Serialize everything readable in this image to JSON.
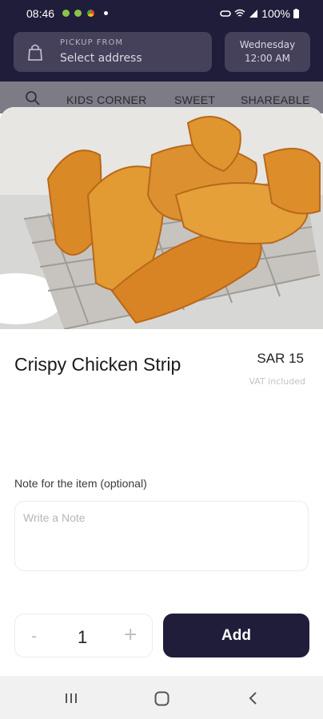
{
  "status_bar": {
    "time": "08:46",
    "battery": "100%",
    "notification_icons": [
      "android-icon",
      "android-icon",
      "chrome-icon",
      "dot-icon"
    ]
  },
  "header": {
    "pickup_label": "PICKUP FROM",
    "pickup_value": "Select address",
    "date_day": "Wednesday",
    "date_time": "12:00 AM"
  },
  "categories": [
    "KIDS CORNER",
    "SWEET",
    "SHAREABLE"
  ],
  "item": {
    "name": "Crispy Chicken Strip",
    "price": "SAR 15",
    "vat_note": "VAT included"
  },
  "note": {
    "label": "Note for the item (optional)",
    "placeholder": "Write a Note",
    "value": ""
  },
  "quantity": {
    "minus": "-",
    "value": "1",
    "plus": "+"
  },
  "add_label": "Add",
  "colors": {
    "brand_dark": "#201d3b",
    "header_field": "#45415a"
  }
}
